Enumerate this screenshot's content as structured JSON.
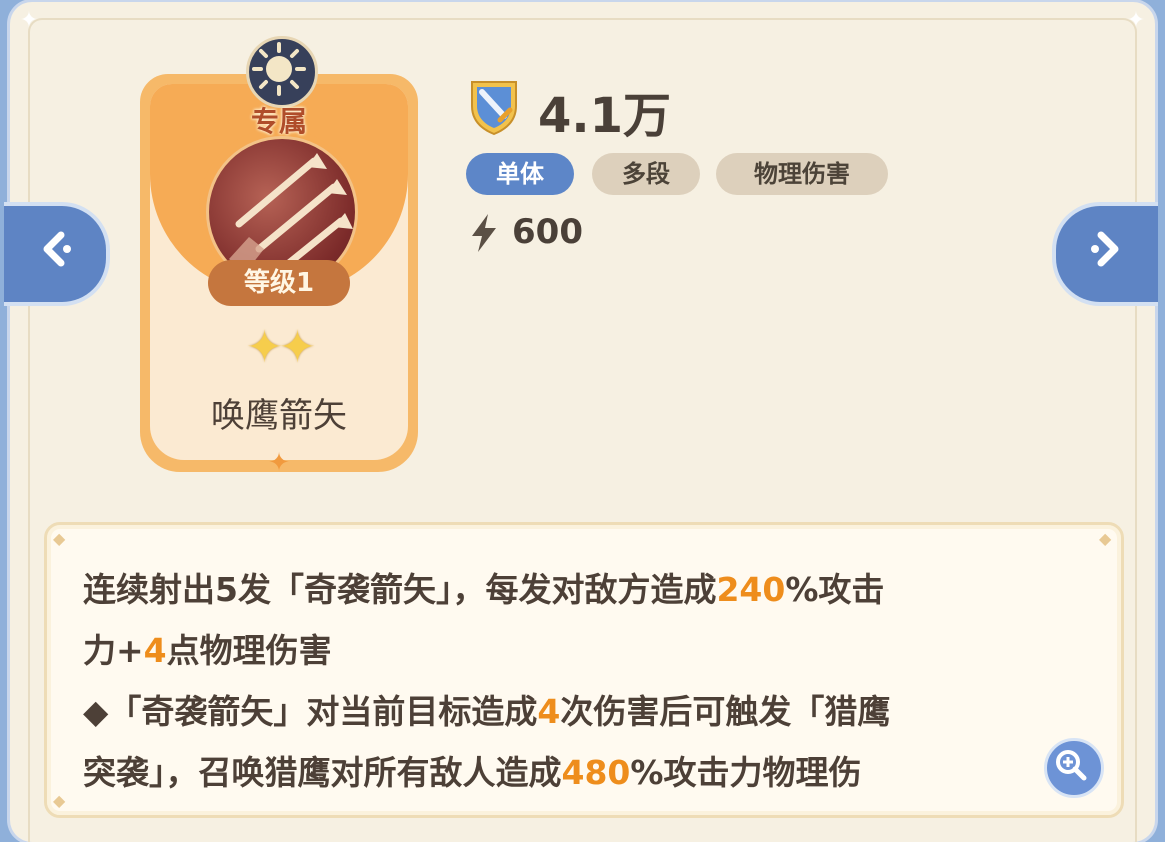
{
  "colors": {
    "panel_bg": "#f6f0e2",
    "card_orange": "#f6ab55",
    "tag_blue": "#5d86c8",
    "tag_beige": "#ddd0bc",
    "highlight_orange": "#ee8d1c",
    "text_dark": "#4d4037"
  },
  "skill_card": {
    "exclusive_label": "专属",
    "level_label": "等级1",
    "stars": "✦✦",
    "star_count": 2,
    "name": "唤鹰箭矢",
    "icon": "arrows-skill-icon",
    "badge_icon": "sun-icon"
  },
  "header": {
    "power_icon": "sword-shield-icon",
    "power_value": "4.1万",
    "tags": [
      {
        "label": "单体",
        "style": "primary"
      },
      {
        "label": "多段",
        "style": "secondary"
      },
      {
        "label": "物理伤害",
        "style": "secondary"
      }
    ],
    "energy_icon": "lightning-icon",
    "energy_value": "600"
  },
  "navigation": {
    "prev_icon": "chevron-left-icon",
    "next_icon": "chevron-right-icon"
  },
  "description": {
    "line1_pre": "连续射出5发「奇袭箭矢」，每发对敌方造成",
    "line1_hl": "240",
    "line1_post": "%攻击",
    "line2_pre": "力+",
    "line2_hl": "4",
    "line2_post": "点物理伤害",
    "line3_pre": "◆「奇袭箭矢」对当前目标造成",
    "line3_hl": "4",
    "line3_post": "次伤害后可触发「猎鹰",
    "line4_pre": "突袭」，召唤猎鹰对所有敌人造成",
    "line4_hl": "480",
    "line4_post": "%攻击力物理伤",
    "zoom_icon": "zoom-in-icon"
  }
}
